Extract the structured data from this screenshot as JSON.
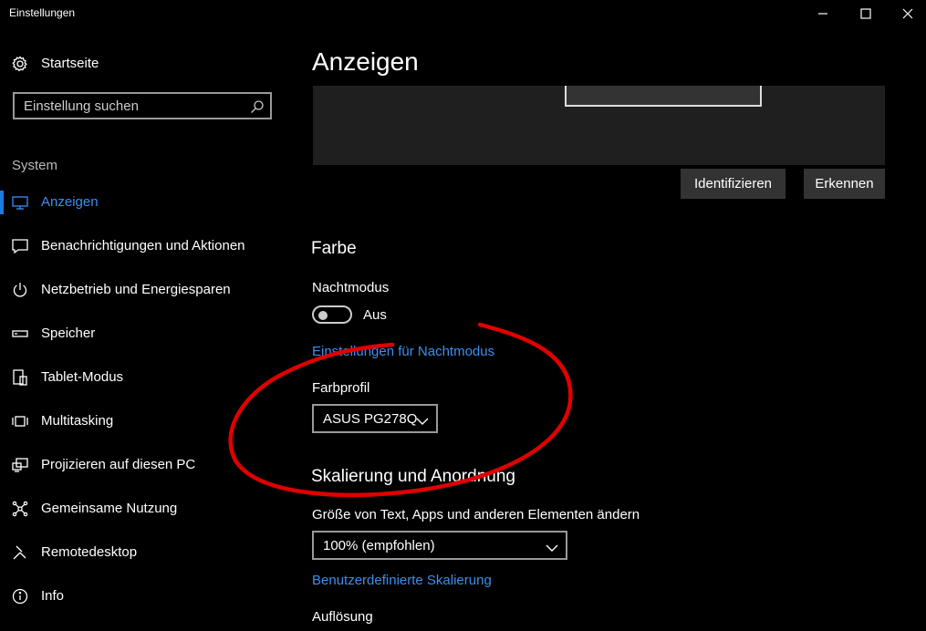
{
  "window": {
    "title": "Einstellungen"
  },
  "sidebar": {
    "home_label": "Startseite",
    "search_placeholder": "Einstellung suchen",
    "section_label": "System",
    "items": [
      {
        "label": "Anzeigen",
        "icon": "monitor-icon",
        "active": true
      },
      {
        "label": "Benachrichtigungen und Aktionen",
        "icon": "notification-icon"
      },
      {
        "label": "Netzbetrieb und Energiesparen",
        "icon": "power-icon"
      },
      {
        "label": "Speicher",
        "icon": "storage-icon"
      },
      {
        "label": "Tablet-Modus",
        "icon": "tablet-icon"
      },
      {
        "label": "Multitasking",
        "icon": "multitasking-icon"
      },
      {
        "label": "Projizieren auf diesen PC",
        "icon": "project-icon"
      },
      {
        "label": "Gemeinsame Nutzung",
        "icon": "share-icon"
      },
      {
        "label": "Remotedesktop",
        "icon": "remote-icon"
      },
      {
        "label": "Info",
        "icon": "info-icon"
      }
    ]
  },
  "main": {
    "page_title": "Anzeigen",
    "identify_button": "Identifizieren",
    "detect_button": "Erkennen",
    "color_heading": "Farbe",
    "night_mode_label": "Nachtmodus",
    "night_mode_state": "Aus",
    "night_mode_link": "Einstellungen für Nachtmodus",
    "color_profile_label": "Farbprofil",
    "color_profile_value": "ASUS PG278Q",
    "scaling_heading": "Skalierung und Anordnung",
    "scale_label": "Größe von Text, Apps und anderen Elementen ändern",
    "scale_value": "100% (empfohlen)",
    "custom_scaling_link": "Benutzerdefinierte Skalierung",
    "resolution_label": "Auflösung"
  },
  "colors": {
    "accent": "#3a8ff0",
    "annotation": "#e00000",
    "background": "#000000"
  }
}
